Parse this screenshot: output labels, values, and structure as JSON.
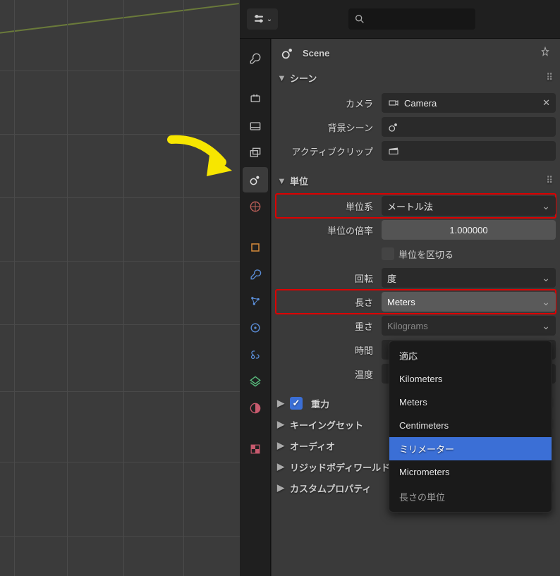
{
  "header": {
    "search_placeholder": ""
  },
  "panel": {
    "title": "Scene",
    "sections": {
      "scene": {
        "label": "シーン",
        "camera_label": "カメラ",
        "camera_value": "Camera",
        "bgscene_label": "背景シーン",
        "activeclip_label": "アクティブクリップ"
      },
      "units": {
        "label": "単位",
        "system_label": "単位系",
        "system_value": "メートル法",
        "scale_label": "単位の倍率",
        "scale_value": "1.000000",
        "separate_label": "単位を区切る",
        "rotation_label": "回転",
        "rotation_value": "度",
        "length_label": "長さ",
        "length_value": "Meters",
        "mass_label": "重さ",
        "mass_value": "Kilograms",
        "time_label": "時間",
        "temperature_label": "温度"
      },
      "gravity": {
        "label": "重力"
      },
      "keying": {
        "label": "キーイングセット"
      },
      "audio": {
        "label": "オーディオ"
      },
      "rigidbody": {
        "label": "リジッドボディワールド"
      },
      "custom": {
        "label": "カスタムプロパティ"
      }
    }
  },
  "dropdown": {
    "items": [
      {
        "text": "適応",
        "underline_index": 0
      },
      {
        "text": "Kilometers",
        "underline_index": 0
      },
      {
        "text": "Meters",
        "underline_index": 0
      },
      {
        "text": "Centimeters",
        "underline_index": 0
      },
      {
        "text": "ミリメーター",
        "selected": true
      },
      {
        "text": "Micrometers",
        "underline_index": 1
      }
    ],
    "caption": "長さの単位"
  },
  "tabs": [
    "tool",
    "render",
    "output",
    "viewlayer",
    "scene",
    "world",
    "object",
    "modifier",
    "particle",
    "physics",
    "constraint",
    "data",
    "material",
    "texture"
  ]
}
